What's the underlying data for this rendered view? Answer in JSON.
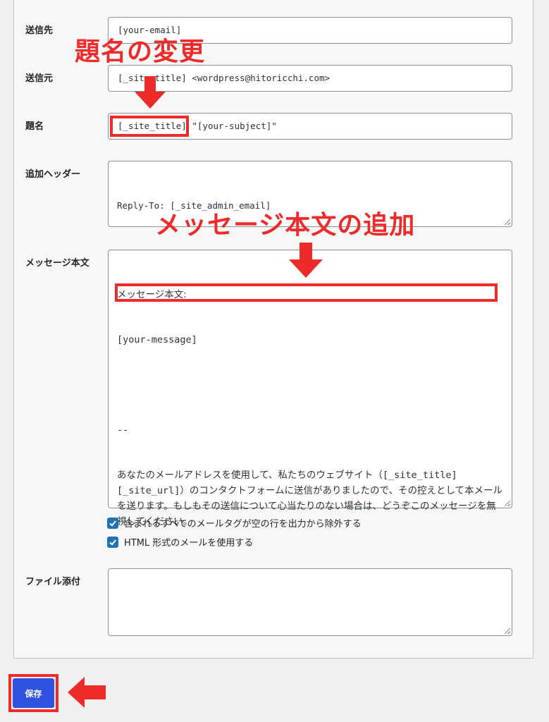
{
  "fields": {
    "to": {
      "label": "送信先",
      "value": "[your-email]"
    },
    "from": {
      "label": "送信元",
      "value": "[_site_title] <wordpress@hitoricchi.com>"
    },
    "subject": {
      "label": "題名",
      "value_tag": "[_site_title]",
      "value_rest": " \"[your-subject]\""
    },
    "headers": {
      "label": "追加ヘッダー",
      "value": "Reply-To: [_site_admin_email]"
    },
    "body": {
      "label": "メッセージ本文",
      "line1": "メッセージ本文:",
      "line2": "[your-message]",
      "line3": "--",
      "paragraph_a": "あなたのメールアドレスを使用して、私たちのウェブサイト（",
      "paragraph_b": "[_site_title] [_site_url]",
      "paragraph_c": "）のコンタクトフォームに送信がありましたので、その控えとして本メールを送ります。もしもその送信について心当たりのない場合は、どうぞこのメッセージを無視してください。"
    },
    "attachments": {
      "label": "ファイル添付",
      "value": ""
    }
  },
  "options": {
    "exclude_blank": "含まれるすべてのメールタグが空の行を出力から除外する",
    "use_html": "HTML 形式のメールを使用する"
  },
  "save_label": "保存",
  "annotations": {
    "subject_change": "題名の変更",
    "body_add": "メッセージ本文の追加"
  },
  "colors": {
    "annotation_red": "#ee2b2b",
    "save_button": "#2f52e0"
  }
}
